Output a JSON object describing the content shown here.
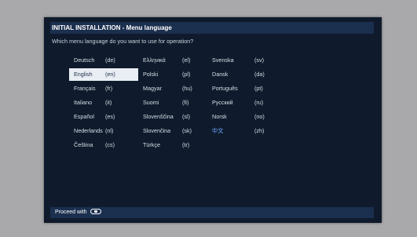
{
  "header": {
    "title": "INITIAL INSTALLATION - Menu language",
    "question": "Which menu language do you want to use for operation?"
  },
  "languages": [
    {
      "name": "Deutsch",
      "code": "(de)"
    },
    {
      "name": "English",
      "code": "(en)"
    },
    {
      "name": "Français",
      "code": "(fr)"
    },
    {
      "name": "Italiano",
      "code": "(it)"
    },
    {
      "name": "Español",
      "code": "(es)"
    },
    {
      "name": "Nederlands",
      "code": "(nl)"
    },
    {
      "name": "Čeština",
      "code": "(cs)"
    },
    {
      "name": "Ελληνικά",
      "code": "(el)"
    },
    {
      "name": "Polski",
      "code": "(pl)"
    },
    {
      "name": "Magyar",
      "code": "(hu)"
    },
    {
      "name": "Suomi",
      "code": "(fi)"
    },
    {
      "name": "Slovenščina",
      "code": "(sl)"
    },
    {
      "name": "Slovenčina",
      "code": "(sk)"
    },
    {
      "name": "Türkçe",
      "code": "(tr)"
    },
    {
      "name": "Svenska",
      "code": "(sv)"
    },
    {
      "name": "Dansk",
      "code": "(da)"
    },
    {
      "name": "Português",
      "code": "(pt)"
    },
    {
      "name": "Русский",
      "code": "(ru)"
    },
    {
      "name": "Norsk",
      "code": "(no)"
    },
    {
      "name": "中文",
      "code": "(zh)"
    }
  ],
  "selected_language": "English",
  "footer": {
    "text": "Proceed with",
    "icon": "ok-button-icon"
  }
}
